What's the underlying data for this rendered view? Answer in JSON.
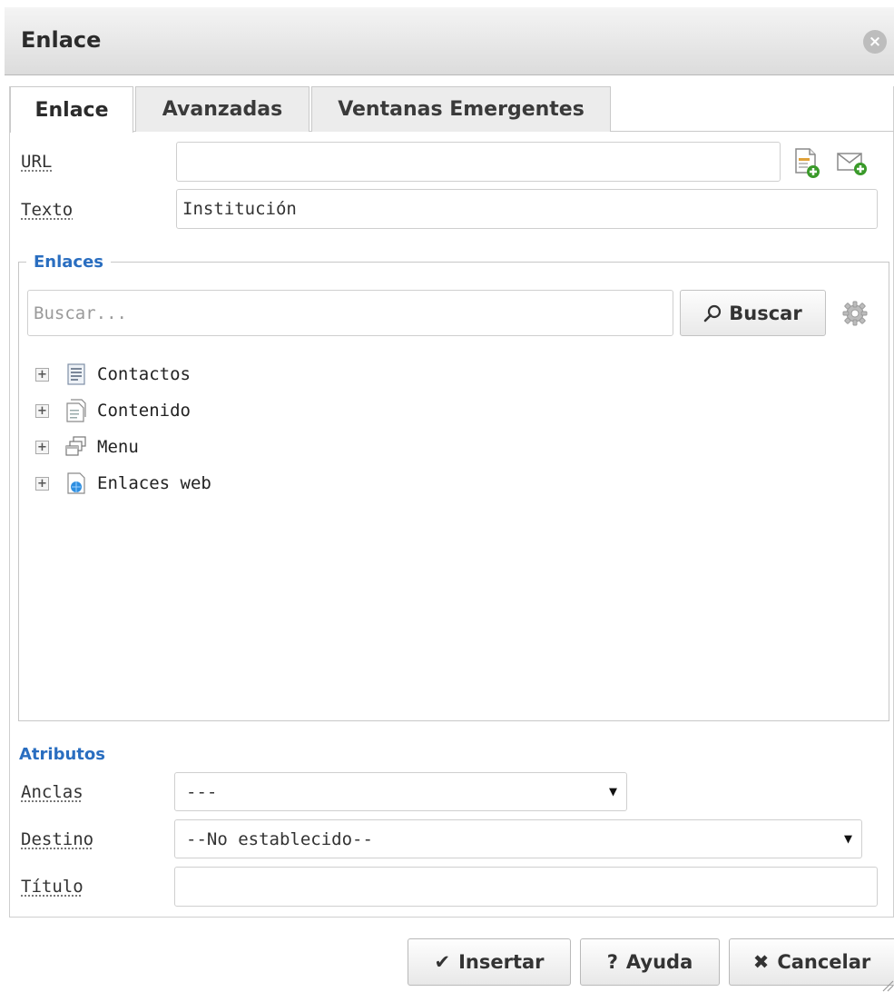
{
  "dialog": {
    "title": "Enlace",
    "close_icon": "close-circle-icon"
  },
  "tabs": [
    {
      "label": "Enlace",
      "active": true
    },
    {
      "label": "Avanzadas",
      "active": false
    },
    {
      "label": "Ventanas Emergentes",
      "active": false
    }
  ],
  "url": {
    "label": "URL",
    "value": "",
    "placeholder": ""
  },
  "texto": {
    "label": "Texto",
    "value": "Institución"
  },
  "enlaces": {
    "legend": "Enlaces",
    "search_placeholder": "Buscar...",
    "search_button": "Buscar",
    "tree": [
      {
        "label": "Contactos",
        "icon": "contacts-document-icon"
      },
      {
        "label": "Contenido",
        "icon": "content-pages-icon"
      },
      {
        "label": "Menu",
        "icon": "menu-windows-icon"
      },
      {
        "label": "Enlaces web",
        "icon": "web-links-icon"
      }
    ]
  },
  "atributos": {
    "title": "Atributos",
    "anclas": {
      "label": "Anclas",
      "value": "---"
    },
    "destino": {
      "label": "Destino",
      "value": "--No establecido--"
    },
    "titulo": {
      "label": "Título",
      "value": ""
    }
  },
  "buttons": {
    "insert": "Insertar",
    "help": "Ayuda",
    "cancel": "Cancelar"
  },
  "colors": {
    "accent": "#2a6ec0",
    "titlebar": "#dcdcdc",
    "border": "#cfcfcf"
  }
}
